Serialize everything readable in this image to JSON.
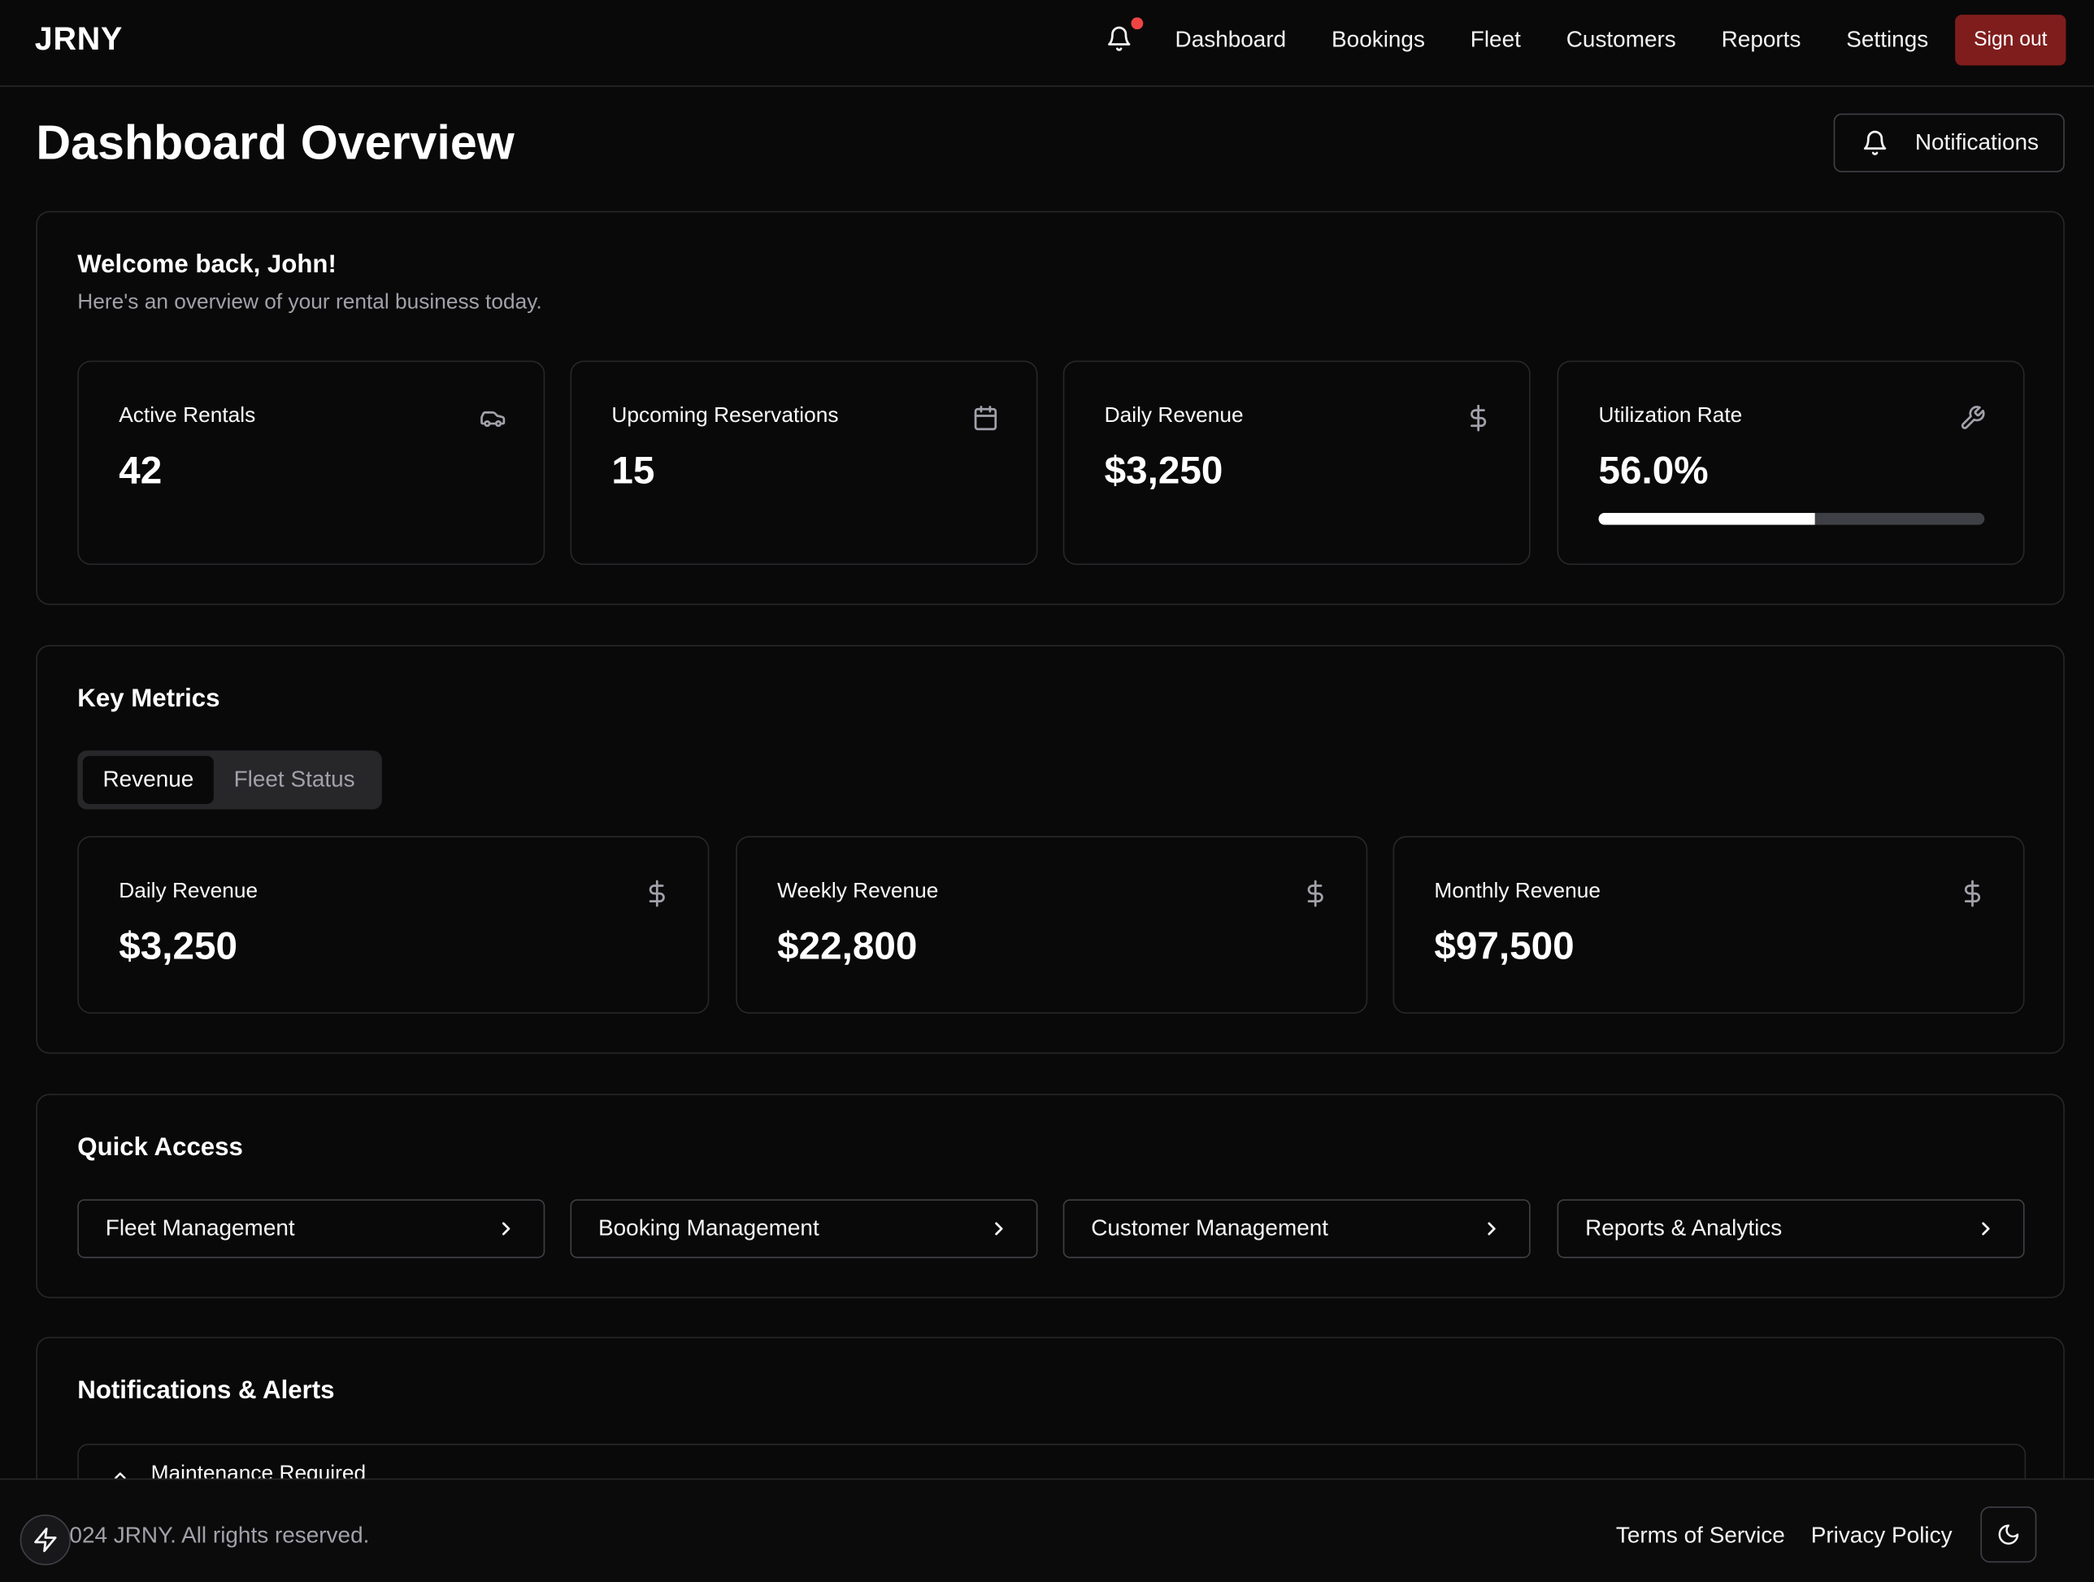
{
  "nav": {
    "brand": "JRNY",
    "links": [
      "Dashboard",
      "Bookings",
      "Fleet",
      "Customers",
      "Reports",
      "Settings"
    ],
    "sign_out": "Sign out",
    "has_unread_notifications": true
  },
  "header": {
    "title": "Dashboard Overview",
    "notifications_button": "Notifications"
  },
  "welcome": {
    "title": "Welcome back, John!",
    "subtitle": "Here's an overview of your rental business today.",
    "stats": [
      {
        "label": "Active Rentals",
        "value": "42",
        "icon": "car-icon"
      },
      {
        "label": "Upcoming Reservations",
        "value": "15",
        "icon": "calendar-icon"
      },
      {
        "label": "Daily Revenue",
        "value": "$3,250",
        "icon": "dollar-icon"
      },
      {
        "label": "Utilization Rate",
        "value": "56.0%",
        "icon": "wrench-icon",
        "progress": 0.56
      }
    ]
  },
  "metrics": {
    "title": "Key Metrics",
    "tabs": [
      "Revenue",
      "Fleet Status"
    ],
    "active_tab": "Revenue",
    "cards": [
      {
        "label": "Daily Revenue",
        "value": "$3,250"
      },
      {
        "label": "Weekly Revenue",
        "value": "$22,800"
      },
      {
        "label": "Monthly Revenue",
        "value": "$97,500"
      }
    ]
  },
  "quick": {
    "title": "Quick Access",
    "items": [
      "Fleet Management",
      "Booking Management",
      "Customer Management",
      "Reports & Analytics"
    ]
  },
  "alerts": {
    "title": "Notifications & Alerts",
    "first_item": "Maintenance Required"
  },
  "footer": {
    "copyright": "024 JRNY. All rights reserved.",
    "terms": "Terms of Service",
    "privacy": "Privacy Policy"
  },
  "colors": {
    "background": "#0a0909",
    "border": "#27272a",
    "accent": "#7f1d1d",
    "notification_dot": "#ef4444"
  }
}
